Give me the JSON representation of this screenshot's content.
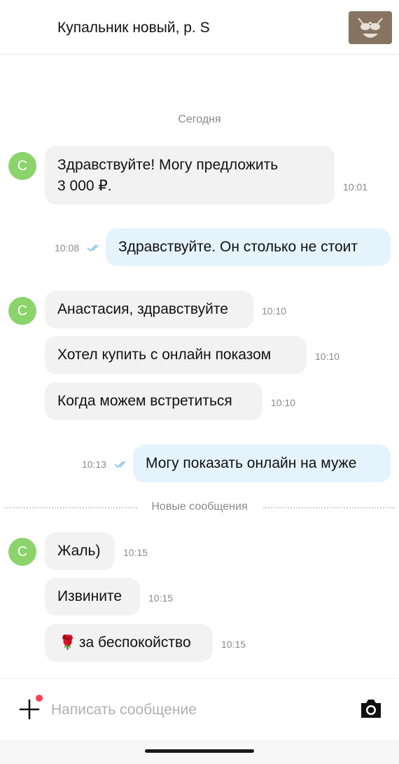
{
  "header": {
    "title": "Купальник новый, р. S",
    "thumbnail_icon": "swimsuit-photo"
  },
  "chat": {
    "day_separator": "Сегодня",
    "avatar_letter": "С",
    "new_messages_separator": "Новые сообщения",
    "messages": [
      {
        "direction": "in",
        "text_line1": "Здравствуйте! Могу предложить",
        "text_line2": "3 000 ₽.",
        "time": "10:01"
      },
      {
        "direction": "out",
        "text": "Здравствуйте. Он столько не стоит",
        "time": "10:08",
        "status_icon": "double-check-icon"
      },
      {
        "direction": "in",
        "text": "Анастасия, здравствуйте",
        "time": "10:10"
      },
      {
        "direction": "in",
        "text": "Хотел купить с онлайн показом",
        "time": "10:10"
      },
      {
        "direction": "in",
        "text": "Когда можем встретиться",
        "time": "10:10"
      },
      {
        "direction": "out",
        "text": "Могу показать онлайн на муже",
        "time": "10:13",
        "status_icon": "double-check-icon"
      },
      {
        "direction": "in",
        "text": "Жаль)",
        "time": "10:15"
      },
      {
        "direction": "in",
        "text": "Извините",
        "time": "10:15"
      },
      {
        "direction": "in",
        "emoji": "🌹",
        "text": "за беспокойство",
        "time": "10:15"
      }
    ]
  },
  "composer": {
    "placeholder": "Написать сообщение",
    "value": "",
    "attach_icon": "plus-icon",
    "camera_icon": "camera-icon"
  },
  "colors": {
    "incoming_bubble": "#f2f2f2",
    "outgoing_bubble": "#e5f3fd",
    "avatar": "#8bd36b",
    "notification_dot": "#ff4053",
    "read_check": "#7fc3ea"
  }
}
